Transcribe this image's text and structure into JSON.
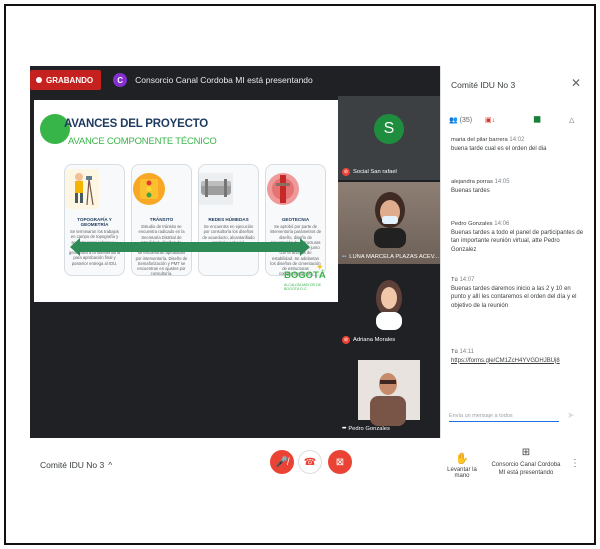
{
  "topbar": {
    "rec_label": "GRABANDO",
    "presenter_initial": "C",
    "presenting_text": "Consorcio Canal Cordoba MI está presentando",
    "rec_color": "#c5221f",
    "avatar_color": "#8430ce"
  },
  "slide": {
    "title": "AVANCES DEL PROYECTO",
    "subtitle": "AVANCE COMPONENTE TÉCNICO",
    "columns": [
      {
        "title": "TOPOGRAFÍA Y GEOMETRÍA",
        "body": "Se terminaron los trabajos en campo de topografía y se entregaron informes y avances de topografía y geometría a la interventoría para aprobación final y posterior entrega al IDU."
      },
      {
        "title": "TRÁNSITO",
        "body": "Estudio de tránsito se encuentra radicado en la Secretaría Distrital de Movilidad, diseños de demarcación y señalización se encuentran aprobados por interventoría. Diseño de Semaforización y PMT se encuentran en ajustes por consultoría."
      },
      {
        "title": "REDES HÚMEDAS",
        "body": "Se encuentra en ejecución por consultoría los diseños de acueducto, alcantarillado sanitario y pluvial."
      },
      {
        "title": "GEOTECNIA",
        "body": "Se aprobó por parte de interventoría parámetros de diseño, diseño de cimentación de estructuras nuevas y contención junto con el análisis de estabilidad. Se adelantan los diseños de cimentación de estructuras complementarias."
      }
    ],
    "logo": "BOGOTÁ",
    "logo_sub": "ALCALDÍA MAYOR DE BOGOTÁ D.C."
  },
  "participants": [
    {
      "name": "Social San rafael",
      "initial": "S",
      "avatar_color": "#1e8e3e"
    },
    {
      "name": "LUNA MARCELA PLAZAS ACEV..."
    },
    {
      "name": "Adriana Morales"
    },
    {
      "name": "Pedro Gonzales"
    }
  ],
  "chat": {
    "title": "Comité IDU No 3",
    "participants_count": "(35)",
    "messages": [
      {
        "author": "maria del pilar barrera",
        "time": "14:02",
        "text": "buena tarde cual es el orden del dia"
      },
      {
        "author": "alejandra porras",
        "time": "14:05",
        "text": "Buenas tardes"
      },
      {
        "author": "Pedro Gonzales",
        "time": "14:06",
        "text": "Buenas tardes a todo el panel de participantes de tan importante reunión virtual, atte Pedro Gonzalez"
      },
      {
        "author": "Tú",
        "time": "14:07",
        "text": "Buenas tardes daremos inicio a las 2 y 10 en punto y allí les contaremos el orden del día y el objetivo de la reunión"
      },
      {
        "author": "Tú",
        "time": "14:11",
        "link": "https://forms.gle/CM1ZcH4YVGDHJBUj8"
      }
    ],
    "input_placeholder": "Envía un mensaje a todos"
  },
  "bottom": {
    "meeting_name": "Comité IDU No 3",
    "raise_hand": "Levantar la mano",
    "presenting": "Consorcio Canal Cordoba MI está presentando"
  }
}
